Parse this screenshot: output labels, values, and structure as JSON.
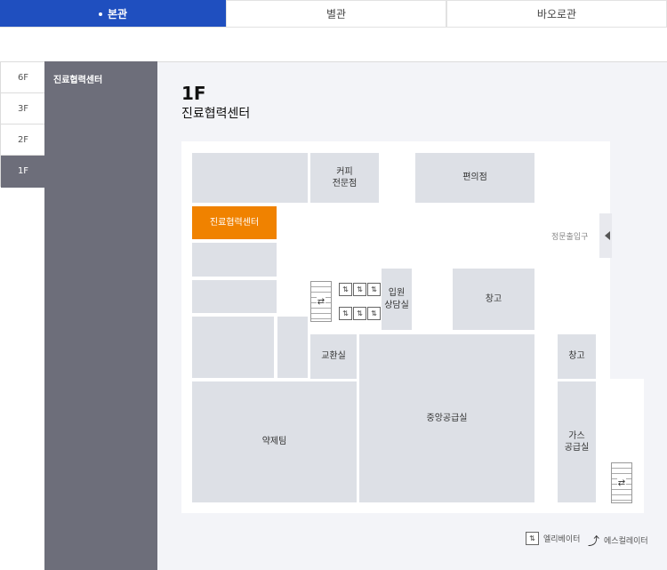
{
  "tabs": [
    {
      "label": "본관",
      "active": true
    },
    {
      "label": "별관",
      "active": false
    },
    {
      "label": "바오로관",
      "active": false
    }
  ],
  "floors": [
    {
      "label": "6F",
      "active": false
    },
    {
      "label": "3F",
      "active": false
    },
    {
      "label": "2F",
      "active": false
    },
    {
      "label": "1F",
      "active": true
    }
  ],
  "departments": [
    "진료협력센터"
  ],
  "map": {
    "floor": "1F",
    "selected_department": "진료협력센터",
    "entrance": "정문출입구",
    "rooms": {
      "coffee_line1": "커피",
      "coffee_line2": "전문점",
      "convenience": "편의점",
      "referral_center": "진료협력센터",
      "admission_line1": "입원",
      "admission_line2": "상담실",
      "storage1": "창고",
      "exchange": "교환실",
      "storage2": "창고",
      "central_supply": "중앙공급실",
      "pharmacy": "약제팀",
      "gas_line1": "가스",
      "gas_line2": "공급실"
    }
  },
  "legend": {
    "elevator": "엘리베이터",
    "escalator": "에스컬레이터"
  },
  "colors": {
    "tab_active": "#1f4fbf",
    "sidebar": "#6d6e7a",
    "highlight": "#f08200",
    "room": "#dde0e6"
  }
}
